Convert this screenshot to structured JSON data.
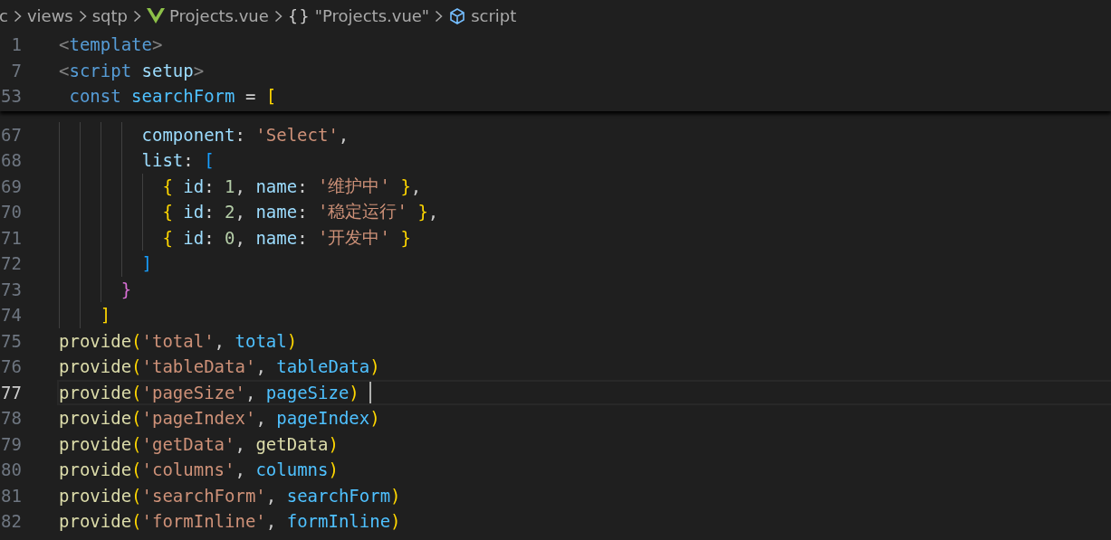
{
  "breadcrumb": [
    {
      "kind": "folder",
      "label": "c"
    },
    {
      "kind": "folder",
      "label": "views"
    },
    {
      "kind": "folder",
      "label": "sqtp"
    },
    {
      "kind": "vue-file",
      "label": "Projects.vue"
    },
    {
      "kind": "object",
      "glyph": "{}",
      "label": "\"Projects.vue\""
    },
    {
      "kind": "symbol",
      "label": "script"
    }
  ],
  "sticky_lines": [
    {
      "number": "1",
      "tokens": [
        {
          "kind": "tagpunct",
          "text": "<"
        },
        {
          "kind": "tag",
          "text": "template"
        },
        {
          "kind": "tagpunct",
          "text": ">"
        }
      ]
    },
    {
      "number": "7",
      "tokens": [
        {
          "kind": "tagpunct",
          "text": "<"
        },
        {
          "kind": "tag",
          "text": "script"
        },
        {
          "kind": "attr",
          "text": " setup"
        },
        {
          "kind": "tagpunct",
          "text": ">"
        }
      ]
    },
    {
      "number": "53",
      "tokens": [
        {
          "kind": "keyword",
          "text": " const"
        },
        {
          "kind": "const",
          "text": " searchForm"
        },
        {
          "kind": "plain",
          "text": " = "
        },
        {
          "kind": "bracket1",
          "text": "["
        }
      ]
    }
  ],
  "lines": [
    {
      "number": "67",
      "current": false,
      "tokens": [
        {
          "kind": "prop",
          "text": "        component"
        },
        {
          "kind": "plain",
          "text": ": "
        },
        {
          "kind": "string",
          "text": "'Select'"
        },
        {
          "kind": "plain",
          "text": ","
        }
      ]
    },
    {
      "number": "68",
      "current": false,
      "tokens": [
        {
          "kind": "prop",
          "text": "        list"
        },
        {
          "kind": "plain",
          "text": ": "
        },
        {
          "kind": "bracket3",
          "text": "["
        }
      ]
    },
    {
      "number": "69",
      "current": false,
      "tokens": [
        {
          "kind": "bracket1",
          "text": "          {"
        },
        {
          "kind": "prop",
          "text": " id"
        },
        {
          "kind": "plain",
          "text": ": "
        },
        {
          "kind": "number",
          "text": "1"
        },
        {
          "kind": "plain",
          "text": ", "
        },
        {
          "kind": "prop",
          "text": "name"
        },
        {
          "kind": "plain",
          "text": ": "
        },
        {
          "kind": "string",
          "text": "'维护中'"
        },
        {
          "kind": "bracket1",
          "text": " }"
        },
        {
          "kind": "plain",
          "text": ","
        }
      ]
    },
    {
      "number": "70",
      "current": false,
      "tokens": [
        {
          "kind": "bracket1",
          "text": "          {"
        },
        {
          "kind": "prop",
          "text": " id"
        },
        {
          "kind": "plain",
          "text": ": "
        },
        {
          "kind": "number",
          "text": "2"
        },
        {
          "kind": "plain",
          "text": ", "
        },
        {
          "kind": "prop",
          "text": "name"
        },
        {
          "kind": "plain",
          "text": ": "
        },
        {
          "kind": "string",
          "text": "'稳定运行'"
        },
        {
          "kind": "bracket1",
          "text": " }"
        },
        {
          "kind": "plain",
          "text": ","
        }
      ]
    },
    {
      "number": "71",
      "current": false,
      "tokens": [
        {
          "kind": "bracket1",
          "text": "          {"
        },
        {
          "kind": "prop",
          "text": " id"
        },
        {
          "kind": "plain",
          "text": ": "
        },
        {
          "kind": "number",
          "text": "0"
        },
        {
          "kind": "plain",
          "text": ", "
        },
        {
          "kind": "prop",
          "text": "name"
        },
        {
          "kind": "plain",
          "text": ": "
        },
        {
          "kind": "string",
          "text": "'开发中'"
        },
        {
          "kind": "bracket1",
          "text": " }"
        }
      ]
    },
    {
      "number": "72",
      "current": false,
      "tokens": [
        {
          "kind": "bracket3",
          "text": "        ]"
        }
      ]
    },
    {
      "number": "73",
      "current": false,
      "tokens": [
        {
          "kind": "bracket2",
          "text": "      }"
        }
      ]
    },
    {
      "number": "74",
      "current": false,
      "tokens": [
        {
          "kind": "bracket1",
          "text": "    ]"
        }
      ]
    },
    {
      "number": "75",
      "current": false,
      "tokens": [
        {
          "kind": "func",
          "text": "provide"
        },
        {
          "kind": "bracket1",
          "text": "("
        },
        {
          "kind": "string",
          "text": "'total'"
        },
        {
          "kind": "plain",
          "text": ", "
        },
        {
          "kind": "const",
          "text": "total"
        },
        {
          "kind": "bracket1",
          "text": ")"
        }
      ]
    },
    {
      "number": "76",
      "current": false,
      "tokens": [
        {
          "kind": "func",
          "text": "provide"
        },
        {
          "kind": "bracket1",
          "text": "("
        },
        {
          "kind": "string",
          "text": "'tableData'"
        },
        {
          "kind": "plain",
          "text": ", "
        },
        {
          "kind": "const",
          "text": "tableData"
        },
        {
          "kind": "bracket1",
          "text": ")"
        }
      ]
    },
    {
      "number": "77",
      "current": true,
      "tokens": [
        {
          "kind": "func",
          "text": "provide"
        },
        {
          "kind": "bracket1",
          "text": "("
        },
        {
          "kind": "string",
          "text": "'pageSize'"
        },
        {
          "kind": "plain",
          "text": ", "
        },
        {
          "kind": "const",
          "text": "pageSize"
        },
        {
          "kind": "bracket1",
          "text": ")"
        }
      ]
    },
    {
      "number": "78",
      "current": false,
      "tokens": [
        {
          "kind": "func",
          "text": "provide"
        },
        {
          "kind": "bracket1",
          "text": "("
        },
        {
          "kind": "string",
          "text": "'pageIndex'"
        },
        {
          "kind": "plain",
          "text": ", "
        },
        {
          "kind": "const",
          "text": "pageIndex"
        },
        {
          "kind": "bracket1",
          "text": ")"
        }
      ]
    },
    {
      "number": "79",
      "current": false,
      "tokens": [
        {
          "kind": "func",
          "text": "provide"
        },
        {
          "kind": "bracket1",
          "text": "("
        },
        {
          "kind": "string",
          "text": "'getData'"
        },
        {
          "kind": "plain",
          "text": ", "
        },
        {
          "kind": "func",
          "text": "getData"
        },
        {
          "kind": "bracket1",
          "text": ")"
        }
      ]
    },
    {
      "number": "80",
      "current": false,
      "tokens": [
        {
          "kind": "func",
          "text": "provide"
        },
        {
          "kind": "bracket1",
          "text": "("
        },
        {
          "kind": "string",
          "text": "'columns'"
        },
        {
          "kind": "plain",
          "text": ", "
        },
        {
          "kind": "const",
          "text": "columns"
        },
        {
          "kind": "bracket1",
          "text": ")"
        }
      ]
    },
    {
      "number": "81",
      "current": false,
      "tokens": [
        {
          "kind": "func",
          "text": "provide"
        },
        {
          "kind": "bracket1",
          "text": "("
        },
        {
          "kind": "string",
          "text": "'searchForm'"
        },
        {
          "kind": "plain",
          "text": ", "
        },
        {
          "kind": "const",
          "text": "searchForm"
        },
        {
          "kind": "bracket1",
          "text": ")"
        }
      ]
    },
    {
      "number": "82",
      "current": false,
      "tokens": [
        {
          "kind": "func",
          "text": "provide"
        },
        {
          "kind": "bracket1",
          "text": "("
        },
        {
          "kind": "string",
          "text": "'formInline'"
        },
        {
          "kind": "plain",
          "text": ", "
        },
        {
          "kind": "const",
          "text": "formInline"
        },
        {
          "kind": "bracket1",
          "text": ")"
        }
      ]
    }
  ]
}
